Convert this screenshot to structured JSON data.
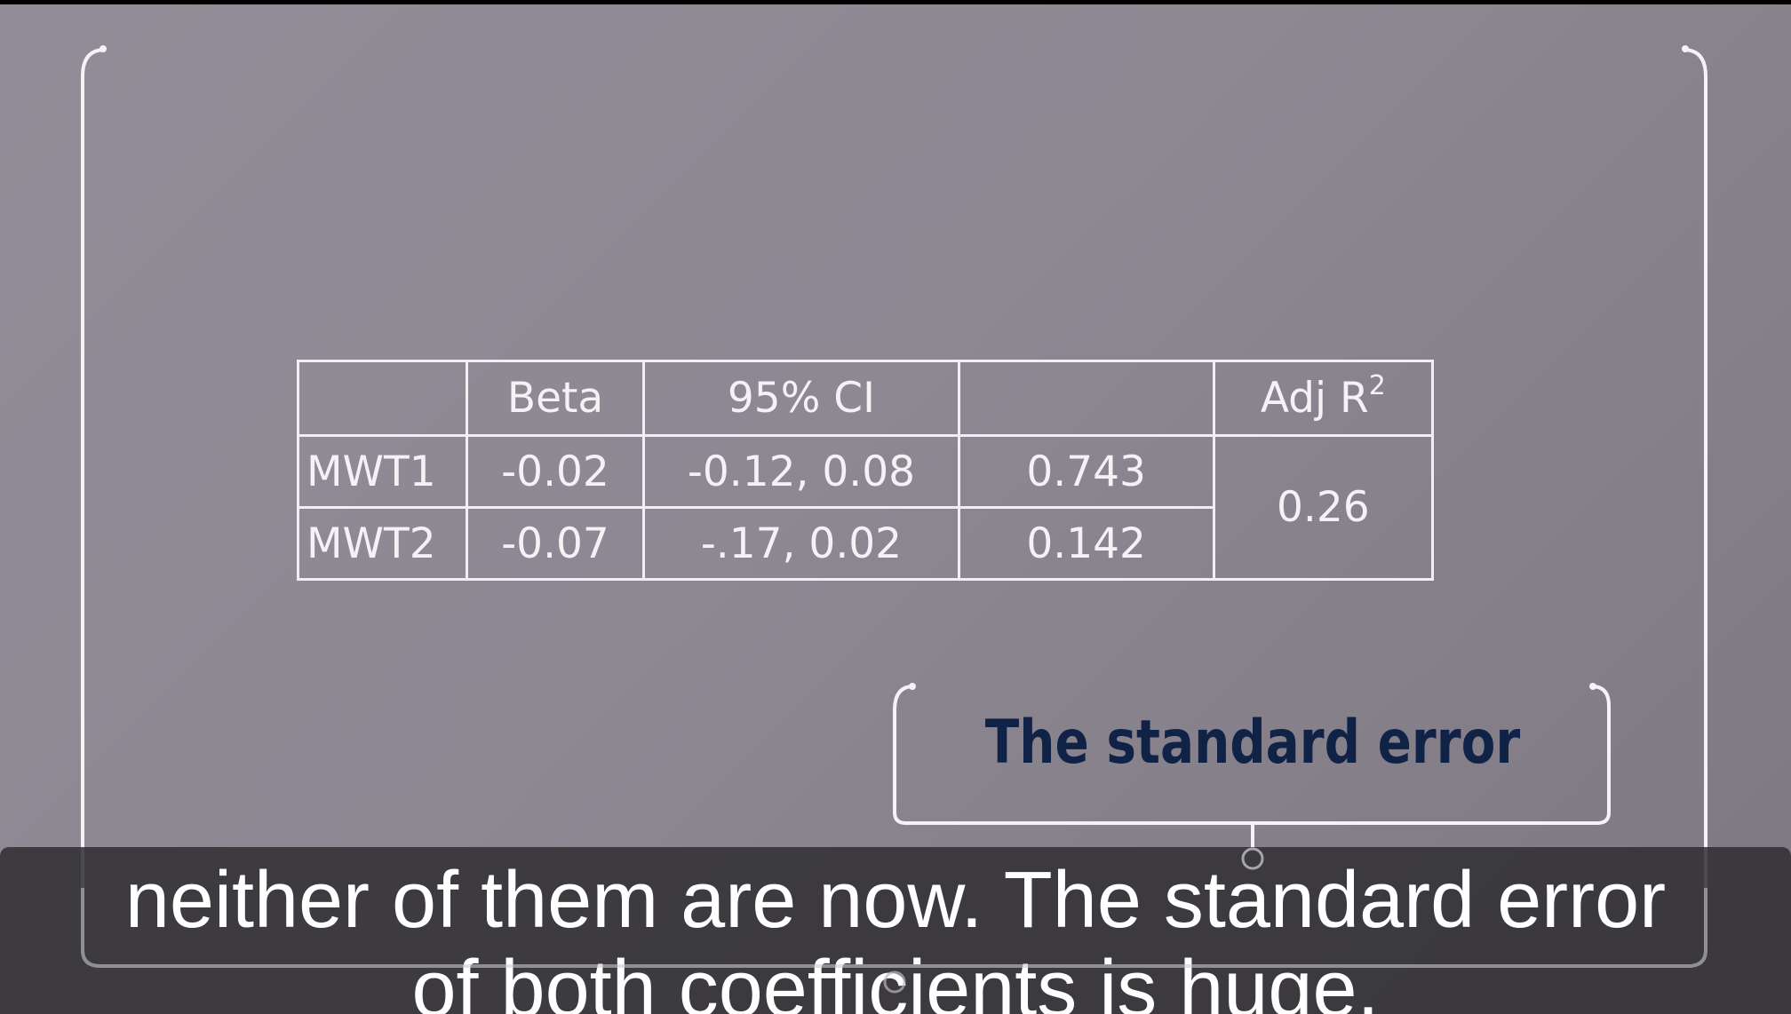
{
  "table": {
    "headers": [
      "",
      "Beta",
      "95% CI",
      "",
      "Adj R",
      "2"
    ],
    "rows": [
      {
        "label": "MWT1",
        "beta": "-0.02",
        "ci": "-0.12, 0.08",
        "p": "0.743"
      },
      {
        "label": "MWT2",
        "beta": "-0.07",
        "ci": "-.17, 0.02",
        "p": "0.142"
      }
    ],
    "adj_r2": "0.26"
  },
  "callout": {
    "title": "The standard error"
  },
  "caption": {
    "line1": "neither of them are now. The standard error",
    "line2": "of both coefficients is huge."
  },
  "colors": {
    "background": "#8e8893",
    "line": "#f0eff3",
    "callout_text": "#102246",
    "caption_bg": "#302e32"
  }
}
